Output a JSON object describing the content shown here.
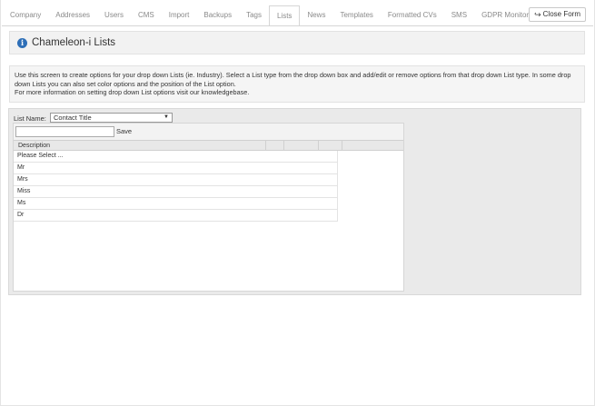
{
  "tabs": [
    {
      "label": "Company",
      "active": false
    },
    {
      "label": "Addresses",
      "active": false
    },
    {
      "label": "Users",
      "active": false
    },
    {
      "label": "CMS",
      "active": false
    },
    {
      "label": "Import",
      "active": false
    },
    {
      "label": "Backups",
      "active": false
    },
    {
      "label": "Tags",
      "active": false
    },
    {
      "label": "Lists",
      "active": true
    },
    {
      "label": "News",
      "active": false
    },
    {
      "label": "Templates",
      "active": false
    },
    {
      "label": "Formatted CVs",
      "active": false
    },
    {
      "label": "SMS",
      "active": false
    },
    {
      "label": "GDPR Monitor",
      "active": false
    }
  ],
  "close_button": {
    "label": "Close Form",
    "icon": "sign-out-icon"
  },
  "header": {
    "title": "Chameleon-i Lists",
    "icon": "info-icon"
  },
  "info": {
    "line1": "Use this screen to create options for your drop down Lists (ie. Industry). Select a List type from the drop down box and add/edit or remove options from that drop down List type. In some drop down Lists you can also set color options and the position of the List option.",
    "line2": "For more information on setting drop down List options visit our knowledgebase."
  },
  "list_selector": {
    "label": "List Name:",
    "selected": "Contact Title"
  },
  "toolbar": {
    "new_value": "",
    "save_label": "Save"
  },
  "grid": {
    "columns": [
      "Description",
      "",
      "",
      ""
    ],
    "rows": [
      "Please Select ...",
      "Mr",
      "Mrs",
      "Miss",
      "Ms",
      "Dr"
    ]
  }
}
